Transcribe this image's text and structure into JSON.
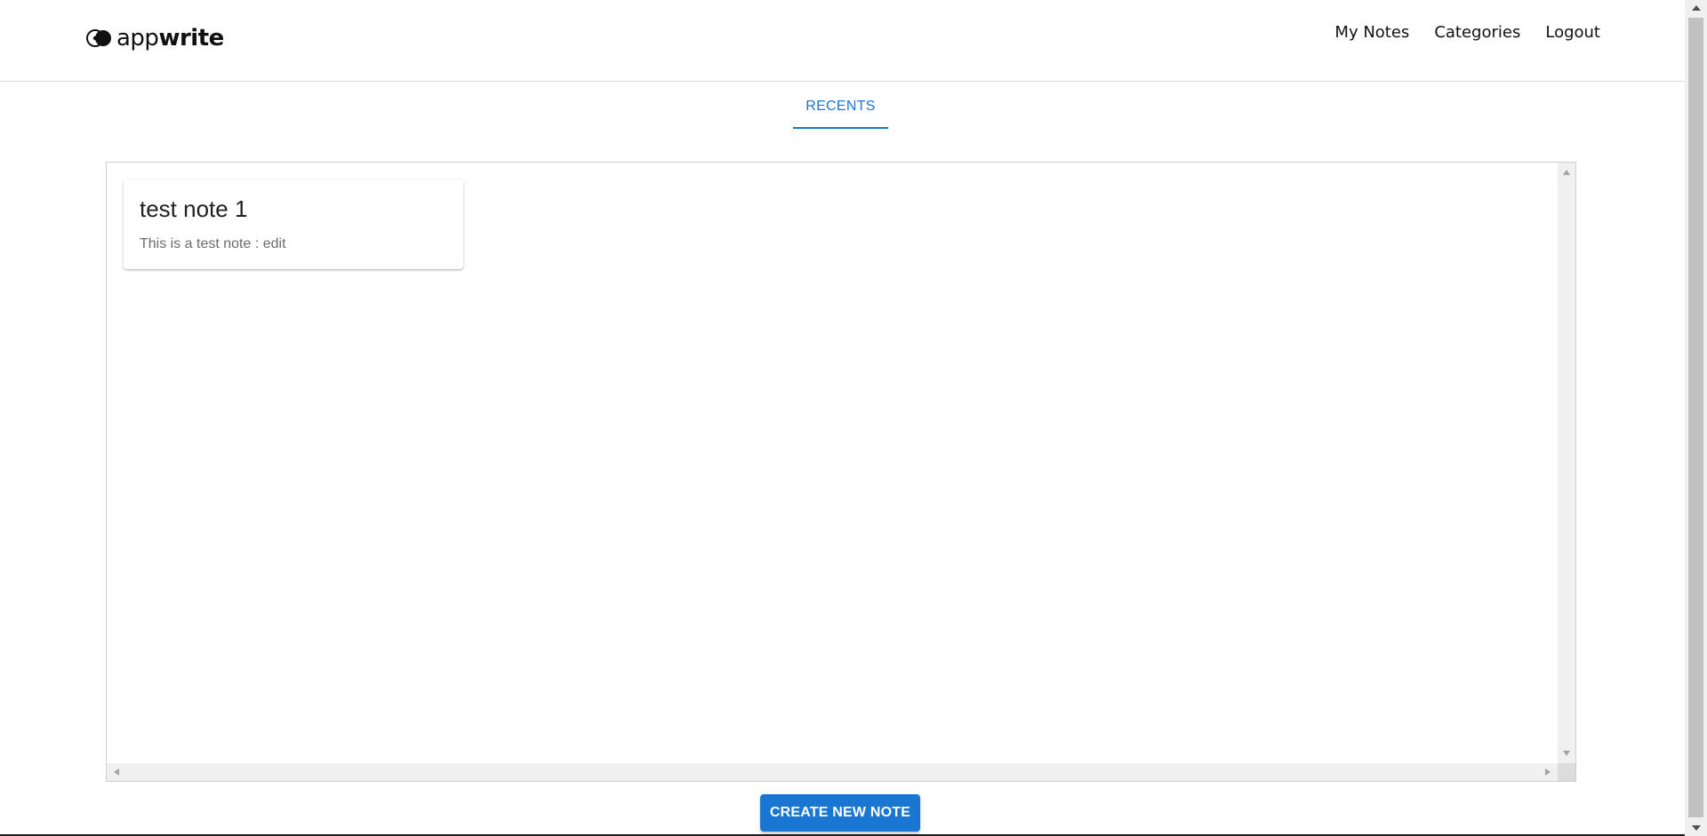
{
  "header": {
    "logo": {
      "text_light": "app",
      "text_bold": "write"
    },
    "nav": [
      {
        "label": "My Notes"
      },
      {
        "label": "Categories"
      },
      {
        "label": "Logout"
      }
    ]
  },
  "tabs": [
    {
      "label": "RECENTS",
      "active": true
    }
  ],
  "notes": [
    {
      "title": "test note 1",
      "body": "This is a test note : edit"
    }
  ],
  "actions": {
    "create_label": "CREATE NEW NOTE"
  },
  "colors": {
    "accent": "#1976d2",
    "text": "#212121",
    "muted": "#6b6b6b"
  }
}
